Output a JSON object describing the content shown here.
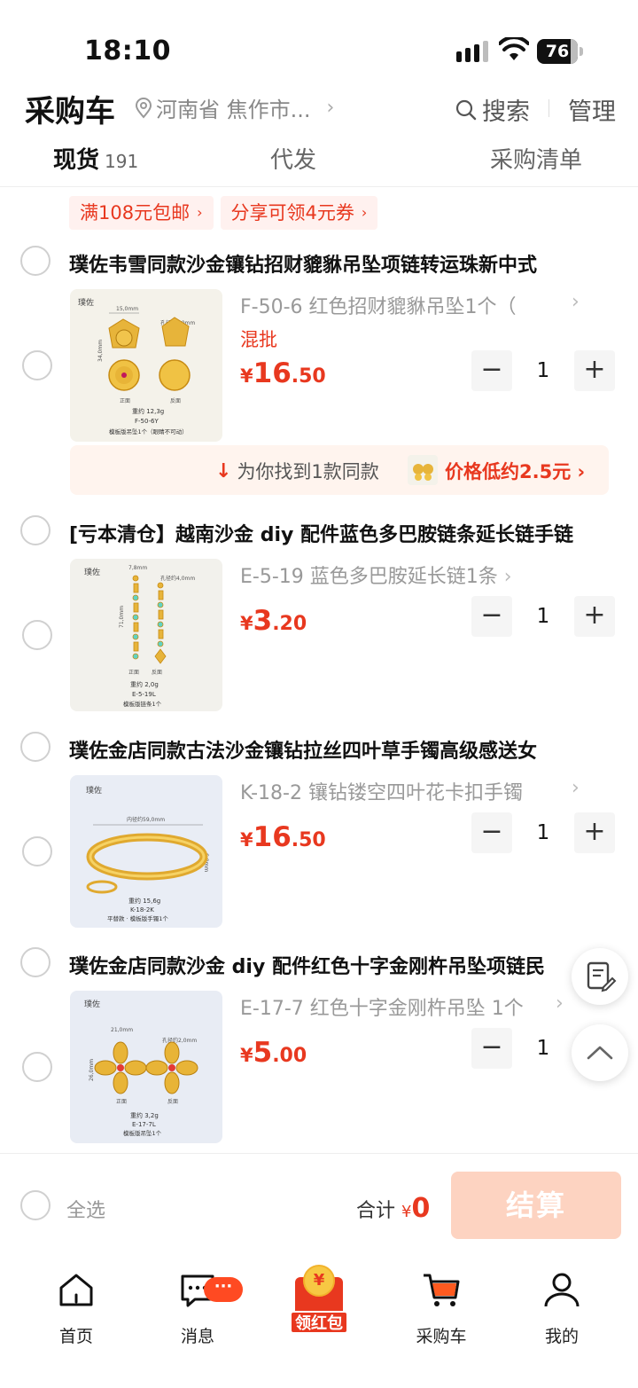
{
  "status": {
    "time": "18:10",
    "battery": "76"
  },
  "header": {
    "title": "采购车",
    "location": "河南省 焦作市...",
    "search_label": "搜索",
    "manage_label": "管理"
  },
  "tabs": [
    {
      "label": "现货",
      "count": "191"
    },
    {
      "label": "代发"
    },
    {
      "label": "采购清单"
    }
  ],
  "promos": [
    "满108元包邮",
    "分享可领4元券"
  ],
  "products": [
    {
      "title": "璞佐韦雪同款沙金镶钻招财貔貅吊坠项链转运珠新中式",
      "sku": "F-50-6 红色招财貔貅吊坠1个（",
      "tag": "混批",
      "price_int": "16",
      "price_dec": ".50",
      "qty": "1",
      "thumb": {
        "brand": "璞佐",
        "w": "15,0mm",
        "h": "34,0mm",
        "hole": "孔径约2,0mm",
        "weight": "重约 12,3g",
        "code": "F-50-6Y",
        "note": "模板版吊坠1个（眼睛不可动）",
        "front": "正面",
        "back": "反面"
      }
    },
    {
      "title": "[亏本清仓】越南沙金 diy 配件蓝色多巴胺链条延长链手链",
      "sku": "E-5-19 蓝色多巴胺延长链1条",
      "price_int": "3",
      "price_dec": ".20",
      "qty": "1",
      "thumb": {
        "brand": "璞佐",
        "w": "7,8mm",
        "h": "71,0mm",
        "hole": "孔径约4,0mm",
        "weight": "重约 2,0g",
        "code": "E-5-19L",
        "note": "模板版链条1个",
        "front": "正面",
        "back": "反面"
      }
    },
    {
      "title": "璞佐金店同款古法沙金镶钻拉丝四叶草手镯高级感送女",
      "sku": "K-18-2 镶钻镂空四叶花卡扣手镯",
      "price_int": "16",
      "price_dec": ".50",
      "qty": "1",
      "thumb": {
        "brand": "璞佐",
        "w": "内径约59,0mm",
        "h": "6,0mm",
        "weight": "重约 15,6g",
        "code": "K-18-2K",
        "note": "平替款 · 模板版手镯1个"
      }
    },
    {
      "title": "璞佐金店同款沙金 diy 配件红色十字金刚杵吊坠项链民",
      "sku": "E-17-7 红色十字金刚杵吊坠 1个",
      "price_int": "5",
      "price_dec": ".00",
      "qty": "1",
      "thumb": {
        "brand": "璞佐",
        "w": "21,0mm",
        "h": "26,0mm",
        "hole": "孔径约2,0mm",
        "weight": "重约 3,2g",
        "code": "E-17-7L",
        "note": "模板版吊坠1个",
        "front": "正面",
        "back": "反面"
      }
    }
  ],
  "similar": {
    "text": "为你找到1款同款",
    "price_text": "价格低约2.5元"
  },
  "checkout": {
    "select_all": "全选",
    "total_label": "合计",
    "currency": "¥",
    "total": "0",
    "pay_label": "结算"
  },
  "nav": [
    {
      "label": "首页",
      "icon": "home-icon"
    },
    {
      "label": "消息",
      "icon": "message-icon",
      "badge": "···"
    },
    {
      "label": "领红包",
      "icon": "red-packet-icon"
    },
    {
      "label": "采购车",
      "icon": "cart-icon"
    },
    {
      "label": "我的",
      "icon": "user-icon"
    }
  ],
  "colors": {
    "accent": "#e8381f",
    "pay_disabled": "#fdd3c1",
    "promo_bg": "#fff1ef"
  }
}
